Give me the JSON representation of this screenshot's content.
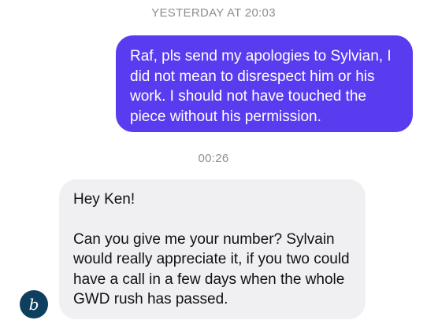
{
  "timestamps": {
    "first": "YESTERDAY AT 20:03",
    "second": "00:26"
  },
  "messages": {
    "outgoing": {
      "text": "Raf, pls send my apologies to Sylvian, I did not mean to disrespect him or his work. I should not have touched the piece without his permission."
    },
    "incoming": {
      "greeting": "Hey Ken!",
      "body": "Can you give me your number? Sylvain would really appreciate it, if you two could have a call in a few days when the whole GWD rush has passed."
    }
  },
  "sender": {
    "avatar_letter": "b"
  },
  "colors": {
    "outgoing_bubble": "#5a3cf0",
    "incoming_bubble": "#f0f0f3",
    "avatar_bg": "#0f3f5f",
    "timestamp_text": "#8e8e93"
  }
}
